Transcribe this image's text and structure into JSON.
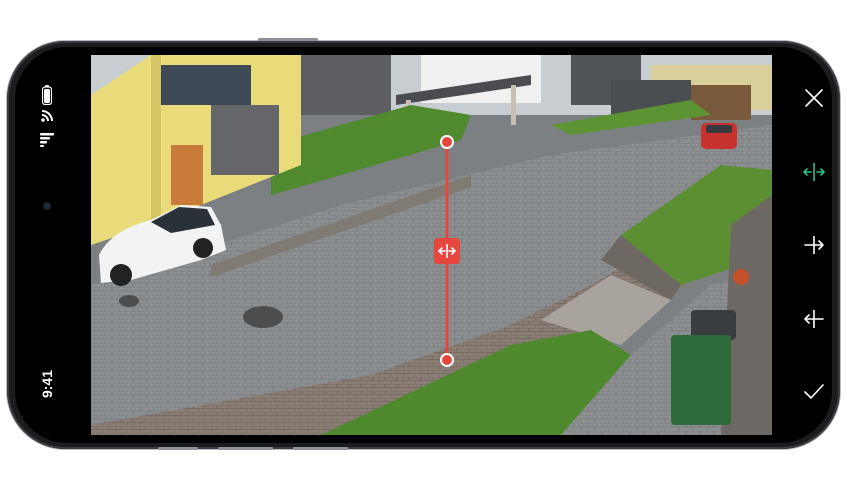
{
  "status": {
    "time": "9:41"
  },
  "accent_color": "#e5473f",
  "active_color": "#2bbd8e",
  "icons": {
    "battery": "battery-icon",
    "signal": "cellular-signal-icon",
    "wifi": "wifi-icon",
    "camera": "front-camera-icon"
  },
  "toolbar": {
    "items": [
      {
        "name": "close",
        "icon": "close-icon",
        "active": false
      },
      {
        "name": "direction-both",
        "icon": "bidirectional-arrow-icon",
        "active": true
      },
      {
        "name": "direction-right",
        "icon": "arrow-right-icon",
        "active": false
      },
      {
        "name": "direction-left",
        "icon": "arrow-left-icon",
        "active": false
      },
      {
        "name": "confirm",
        "icon": "checkmark-icon",
        "active": false
      }
    ]
  },
  "crossing_line": {
    "direction": "both",
    "handles": [
      "top",
      "bottom"
    ]
  }
}
